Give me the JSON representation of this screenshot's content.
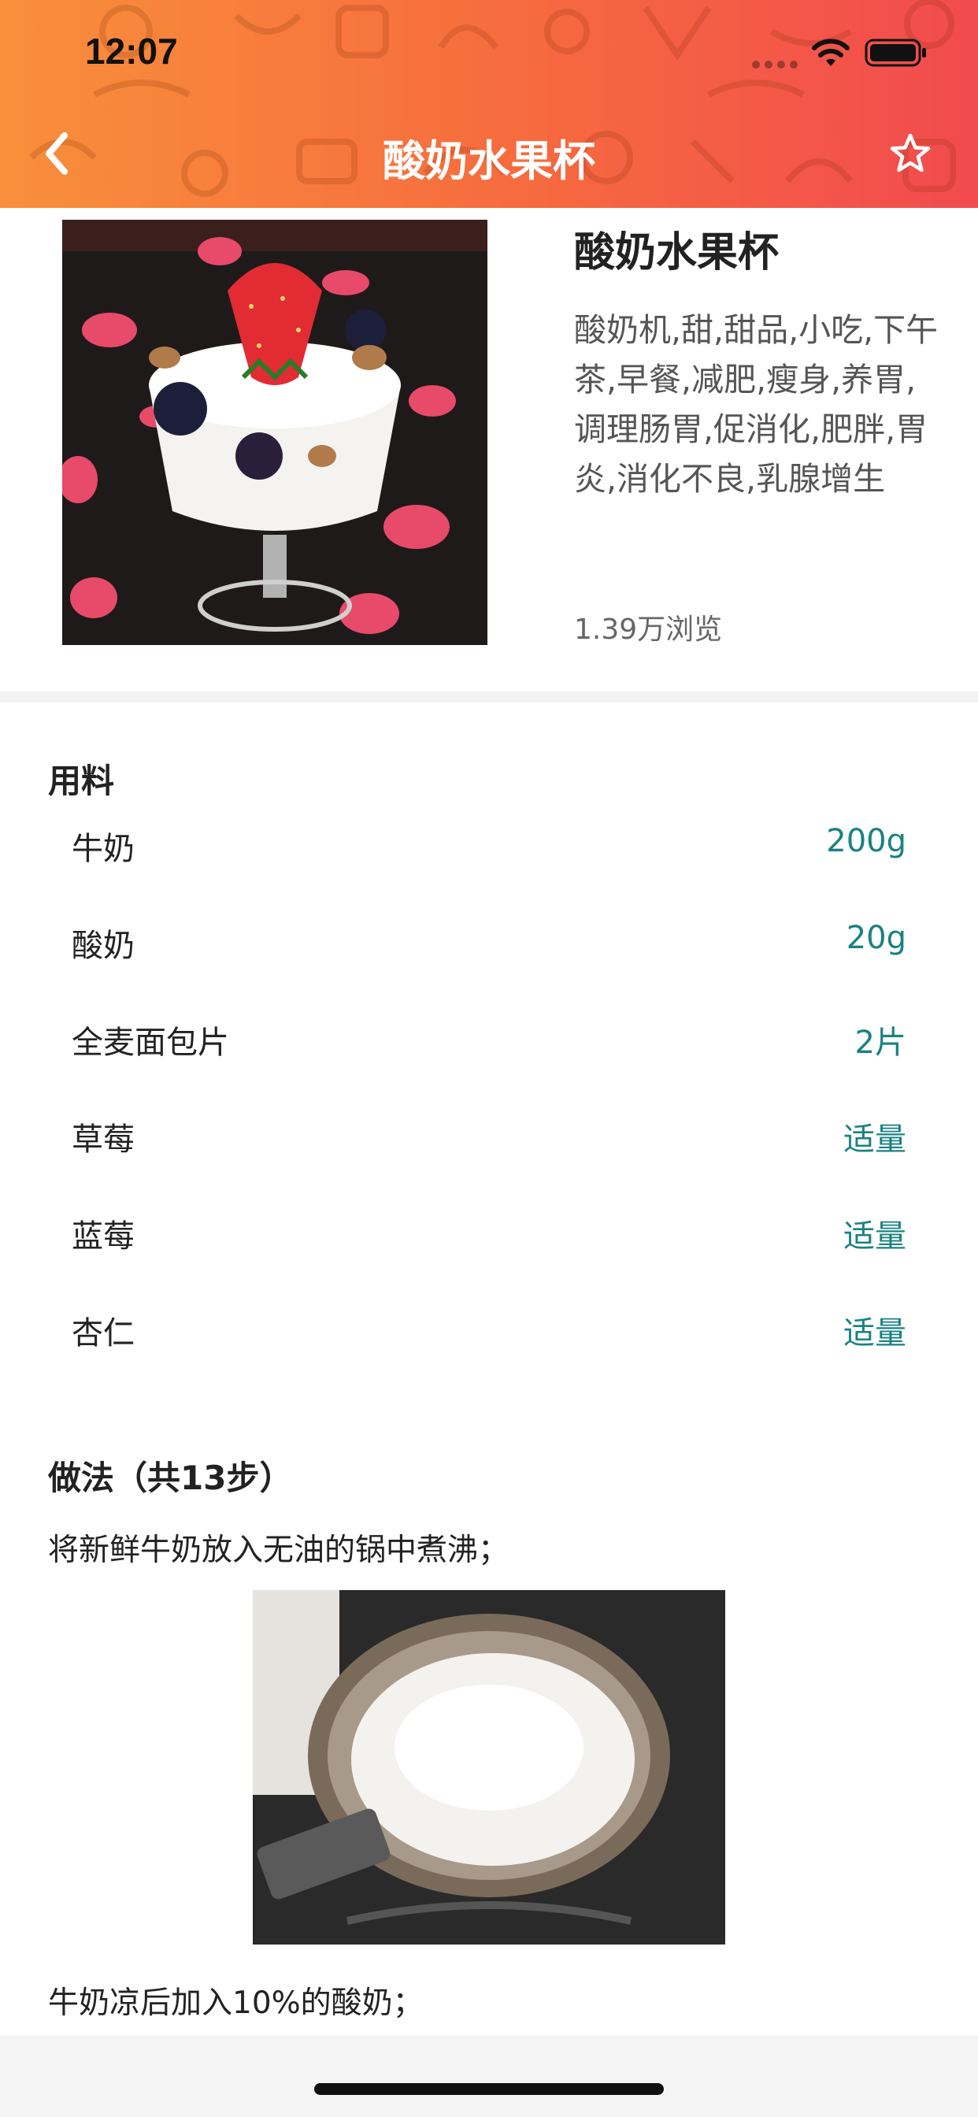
{
  "status_bar": {
    "time": "12:07"
  },
  "nav": {
    "title": "酸奶水果杯"
  },
  "recipe": {
    "name": "酸奶水果杯",
    "tags": "酸奶机,甜,甜品,小吃,下午茶,早餐,减肥,瘦身,养胃,调理肠胃,促消化,肥胖,胃炎,消化不良,乳腺增生",
    "views": "1.39万浏览"
  },
  "ingredients": {
    "title": "用料",
    "items": [
      {
        "name": "牛奶",
        "amount": "200g"
      },
      {
        "name": "酸奶",
        "amount": "20g"
      },
      {
        "name": "全麦面包片",
        "amount": "2片"
      },
      {
        "name": "草莓",
        "amount": "适量"
      },
      {
        "name": "蓝莓",
        "amount": "适量"
      },
      {
        "name": "杏仁",
        "amount": "适量"
      }
    ]
  },
  "steps": {
    "title": "做法（共13步）",
    "items": [
      {
        "text": "将新鲜牛奶放入无油的锅中煮沸；"
      },
      {
        "text": "牛奶凉后加入10%的酸奶；"
      }
    ]
  },
  "colors": {
    "header_gradient_start": "#f98f3b",
    "header_gradient_end": "#f24a4f",
    "amount_text": "#1a8181"
  },
  "icons": {
    "back": "chevron-left-icon",
    "favorite": "star-outline-icon",
    "wifi": "wifi-icon",
    "battery": "battery-icon"
  }
}
